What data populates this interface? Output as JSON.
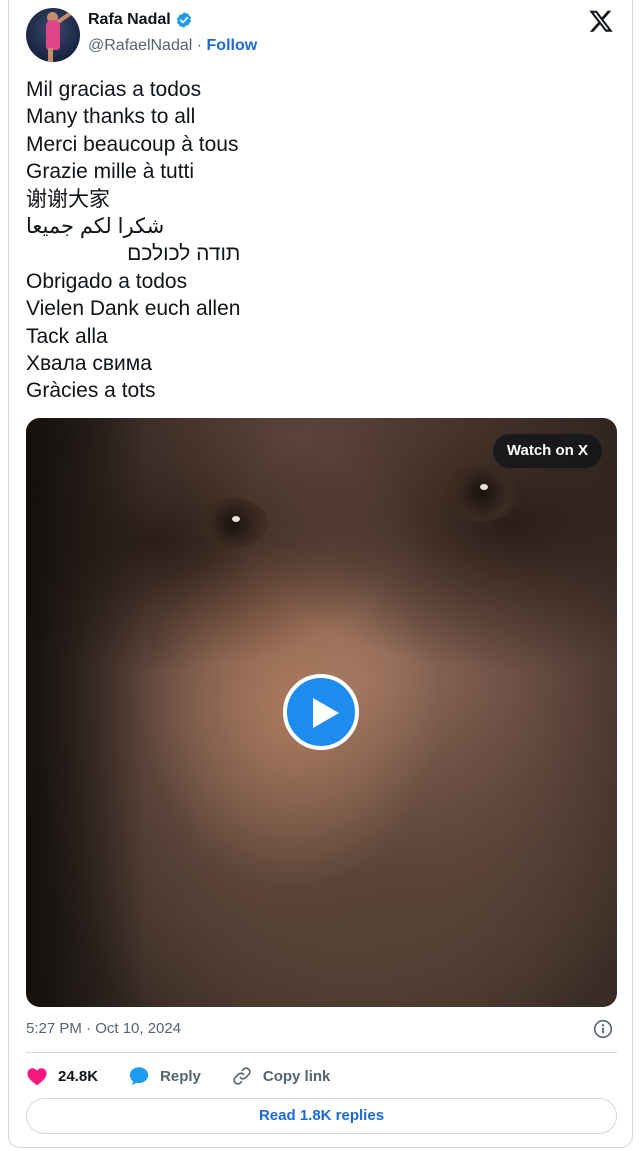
{
  "author": {
    "name": "Rafa Nadal",
    "handle": "@RafaelNadal",
    "separator": "·",
    "follow_label": "Follow",
    "verified": true
  },
  "platform_logo": "x-logo-icon",
  "tweet_lines": [
    "Mil gracias a todos",
    "Many thanks to all",
    "Merci beaucoup à tous",
    "Grazie mille à tutti",
    "谢谢大家",
    "شكرا لكم جميعا",
    "תודה לכולכם",
    "Obrigado a todos",
    "Vielen Dank euch allen",
    "Tack alla",
    "Хвала свима",
    "Gràcies a tots"
  ],
  "media": {
    "type": "video",
    "watch_label": "Watch on X",
    "play_icon": "play-icon"
  },
  "meta": {
    "timestamp": "5:27 PM · Oct 10, 2024"
  },
  "actions": {
    "likes_count": "24.8K",
    "reply_label": "Reply",
    "copy_link_label": "Copy link"
  },
  "footer": {
    "read_replies_label": "Read 1.8K replies"
  },
  "colors": {
    "link_blue": "#1d6ad5",
    "verified_blue": "#1d9bf0",
    "like_pink": "#f91880",
    "text_primary": "#0f1419",
    "text_secondary": "#536471"
  }
}
